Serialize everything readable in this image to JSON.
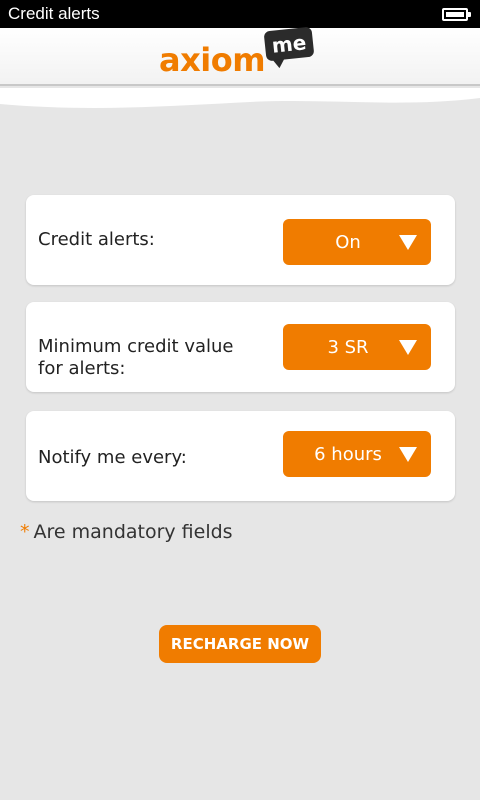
{
  "status_bar": {
    "title": "Credit alerts",
    "battery_icon": "battery-full-icon"
  },
  "header": {
    "logo_text": "axiom",
    "logo_bubble": "me"
  },
  "settings": [
    {
      "label": "Credit alerts:",
      "value": "On"
    },
    {
      "label": "Minimum credit value for alerts:",
      "value": "3 SR"
    },
    {
      "label": "Notify me every:",
      "value": "6 hours"
    }
  ],
  "note": {
    "asterisk": "*",
    "text": "Are mandatory fields"
  },
  "recharge_button": {
    "label": "RECHARGE NOW"
  },
  "colors": {
    "accent": "#f07c00",
    "background": "#e6e6e6",
    "card": "#ffffff"
  }
}
